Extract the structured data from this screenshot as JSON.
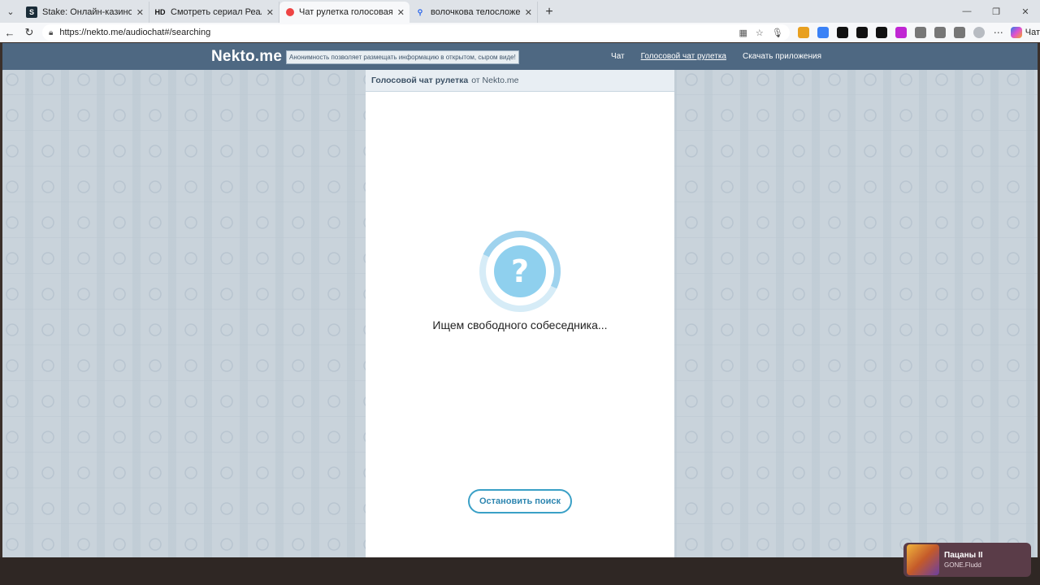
{
  "browser": {
    "tabs": [
      {
        "title": "Stake: Онлайн-казино и ставки н",
        "icon": "stake-icon",
        "active": false
      },
      {
        "title": "Смотреть сериал Реальные пацан",
        "icon": "hd-icon",
        "icon_text": "HD",
        "active": false
      },
      {
        "title": "Чат рулетка голосовая — Ne",
        "icon": "nekto-icon",
        "active": true
      },
      {
        "title": "волочкова телосложение - Searc",
        "icon": "search-icon",
        "active": false
      }
    ],
    "new_tab": "+",
    "url": "https://nekto.me/audiochat#/searching",
    "copilot_label": "Чат"
  },
  "site": {
    "logo": "Nekto.me",
    "tagline": "Анонимность позволяет размещать информацию в открытом, сыром виде!",
    "nav": [
      {
        "label": "Чат"
      },
      {
        "label": "Голосовой чат рулетка"
      },
      {
        "label": "Скачать приложения"
      }
    ]
  },
  "panel": {
    "header_bold": "Голосовой чат рулетка",
    "header_rest": "от Nekto.me",
    "status": "Ищем свободного собеседника...",
    "spinner_glyph": "?",
    "stop_button": "Остановить поиск"
  },
  "media": {
    "title": "Пацаны II",
    "artist": "GONE.Fludd"
  },
  "colors": {
    "header_bg": "#4e6882",
    "accent": "#3aa0c6",
    "spinner": "#8fd0ee"
  }
}
